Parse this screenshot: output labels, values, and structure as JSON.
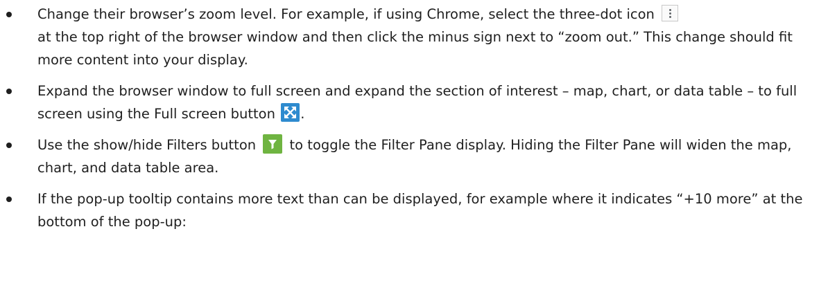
{
  "bullets": [
    {
      "before": "Change their browser’s zoom level. For example, if using Chrome, select the three-dot icon",
      "icon": "three-dot-menu-icon",
      "after": "at the top right of the browser window and then click the minus sign next to “zoom out.” This change should fit more content into your display."
    },
    {
      "before": "Expand the browser window to full screen and expand the section of interest – map, chart, or data table – to full screen using the Full screen button",
      "icon": "fullscreen-icon",
      "after": "."
    },
    {
      "before": "Use the show/hide Filters button",
      "icon": "filter-icon",
      "after": "to toggle the Filter Pane display. Hiding the Filter Pane will widen the map, chart, and data table area."
    },
    {
      "text": "If the pop-up tooltip contains more text than can be displayed, for example where it indicates “+10 more” at the bottom of the pop-up:"
    }
  ],
  "colors": {
    "fullscreen_button": "#2e8bcf",
    "filter_button": "#6fb441",
    "text": "#1f1f1f"
  }
}
